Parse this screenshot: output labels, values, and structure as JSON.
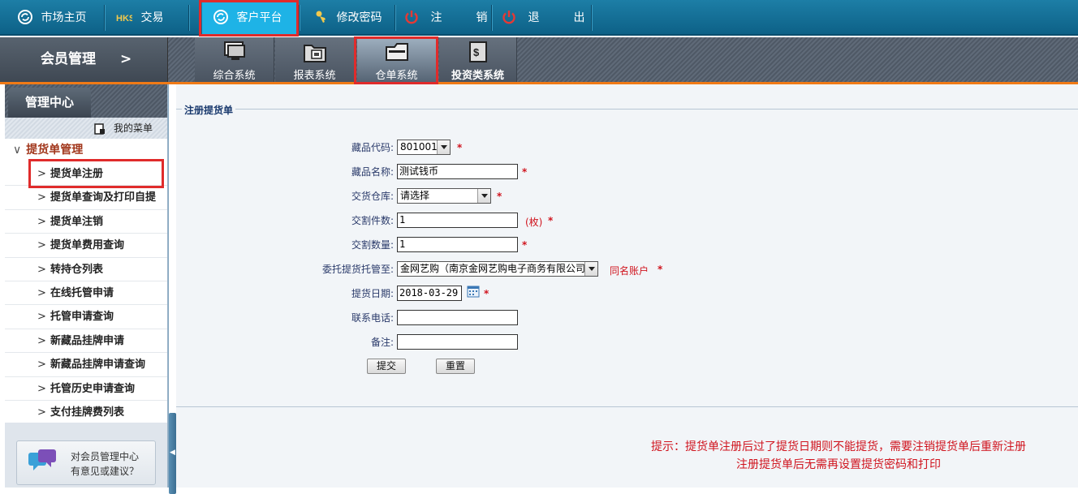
{
  "topnav": {
    "market_home": "市场主页",
    "trade": "交易",
    "customer_platform": "客户平台",
    "change_password": "修改密码",
    "logout": "注　销",
    "exit": "退　出"
  },
  "subnav": {
    "member_mgmt": "会员管理",
    "member_mgmt_arrow": ">",
    "tabs": [
      {
        "label": "综合系统",
        "icon": "monitor-icon"
      },
      {
        "label": "报表系统",
        "icon": "folder-report-icon"
      },
      {
        "label": "仓单系统",
        "icon": "folder-warehouse-icon"
      },
      {
        "label": "投资类系统",
        "icon": "investment-icon"
      }
    ],
    "active_tab": "仓单系统"
  },
  "sidebar": {
    "tab": "管理中心",
    "my_menu": "我的菜单",
    "group": "提货单管理",
    "items": [
      {
        "label": "提货单注册",
        "highlighted": true
      },
      {
        "label": "提货单查询及打印自提"
      },
      {
        "label": "提货单注销"
      },
      {
        "label": "提货单费用查询"
      },
      {
        "label": "转持仓列表"
      },
      {
        "label": "在线托管申请"
      },
      {
        "label": "托管申请查询"
      },
      {
        "label": "新藏品挂牌申请"
      },
      {
        "label": "新藏品挂牌申请查询"
      },
      {
        "label": "托管历史申请查询"
      },
      {
        "label": "支付挂牌费列表"
      }
    ],
    "feedback_line1": "对会员管理中心",
    "feedback_line2": "有意见或建议？"
  },
  "form": {
    "legend": "注册提货单",
    "fields": {
      "item_code": {
        "label": "藏品代码:",
        "value": "801001"
      },
      "item_name": {
        "label": "藏品名称:",
        "value": "测试钱币"
      },
      "warehouse": {
        "label": "交货仓库:",
        "value": "请选择"
      },
      "delivery_pieces": {
        "label": "交割件数:",
        "value": "1",
        "unit": "(枚)"
      },
      "delivery_quantity": {
        "label": "交割数量:",
        "value": "1"
      },
      "custodian": {
        "label": "委托提货托管至:",
        "value": "金网艺购（南京金网艺购电子商务有限公司）",
        "note": "同名账户"
      },
      "pickup_date": {
        "label": "提货日期:",
        "value": "2018-03-29"
      },
      "phone": {
        "label": "联系电话:",
        "value": ""
      },
      "remark": {
        "label": "备注:",
        "value": ""
      }
    },
    "required_mark": "*",
    "submit": "提交",
    "reset": "重置"
  },
  "hint": {
    "line1": "提示：提货单注册后过了提货日期则不能提货，需要注销提货单后重新注册",
    "line2": "注册提货单后无需再设置提货密码和打印"
  },
  "colors": {
    "highlight_box": "#e02b2b",
    "top_bar": "#0d6187",
    "accent_orange": "#f07a16",
    "required_red": "#d0141e"
  }
}
